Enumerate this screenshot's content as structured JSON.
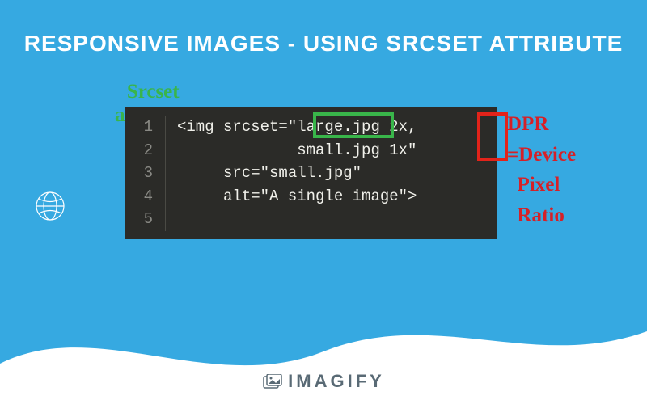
{
  "title": "RESPONSIVE IMAGES - USING SRCSET ATTRIBUTE",
  "code": {
    "lines": [
      {
        "num": "1",
        "text": "<img srcset=\"large.jpg 2x,"
      },
      {
        "num": "2",
        "text": "             small.jpg 1x\""
      },
      {
        "num": "3",
        "text": "     src=\"small.jpg\""
      },
      {
        "num": "4",
        "text": "     alt=\"A single image\">"
      },
      {
        "num": "5",
        "text": ""
      }
    ]
  },
  "annotations": {
    "srcset_label": "Srcset\nattribute",
    "dpr_label": "DPR\n=Device\n  Pixel\n  Ratio"
  },
  "footer": {
    "brand": "IMAGIFY"
  },
  "colors": {
    "background": "#36a9e1",
    "highlight_green": "#39b54a",
    "highlight_red": "#e2231a",
    "code_bg": "#2b2b28"
  }
}
